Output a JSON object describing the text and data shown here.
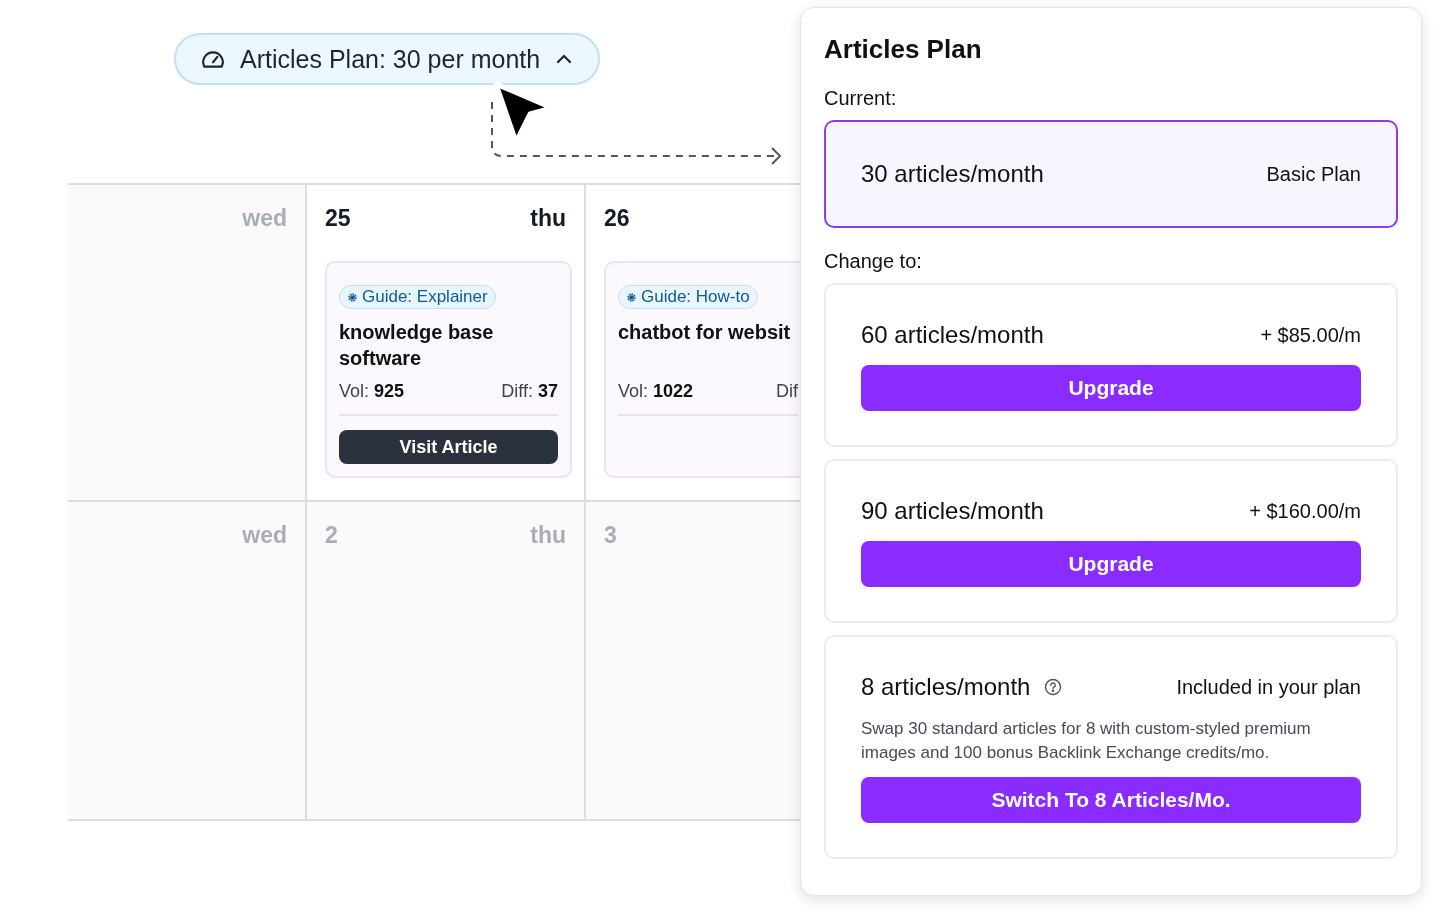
{
  "plan_button": {
    "label": "Articles Plan: 30 per month",
    "expanded": true
  },
  "calendar": {
    "weeks": [
      {
        "days": [
          {
            "weekday": "wed",
            "muted": true
          },
          {
            "date": "25",
            "weekday": "thu",
            "muted": false,
            "articles": [
              {
                "tag": "Guide: Explainer",
                "title": "knowledge base software",
                "vol_label": "Vol:",
                "vol": "925",
                "diff_label": "Diff:",
                "diff": "37",
                "action": "Visit Article"
              }
            ]
          },
          {
            "date": "26",
            "muted": false,
            "articles": [
              {
                "tag": "Guide: How-to",
                "title": "chatbot for websit",
                "vol_label": "Vol:",
                "vol": "1022",
                "diff_label": "Dif"
              }
            ]
          }
        ]
      },
      {
        "days": [
          {
            "weekday": "wed",
            "muted": true
          },
          {
            "date": "2",
            "weekday": "thu",
            "muted": true
          },
          {
            "date": "3",
            "muted": true
          }
        ]
      }
    ]
  },
  "panel": {
    "title": "Articles Plan",
    "current_label": "Current:",
    "current": {
      "name": "30 articles/month",
      "plan": "Basic Plan"
    },
    "change_label": "Change to:",
    "options": [
      {
        "kind": "upgrade",
        "name": "60 articles/month",
        "price": "+ $85.00/m",
        "action": "Upgrade"
      },
      {
        "kind": "upgrade",
        "name": "90 articles/month",
        "price": "+ $160.00/m",
        "action": "Upgrade"
      },
      {
        "kind": "swap",
        "name": "8 articles/month",
        "price": "Included in your plan",
        "description": "Swap 30 standard articles for 8 with custom-styled premium images and 100 bonus Backlink Exchange credits/mo.",
        "action": "Switch To 8 Articles/Mo."
      }
    ]
  }
}
